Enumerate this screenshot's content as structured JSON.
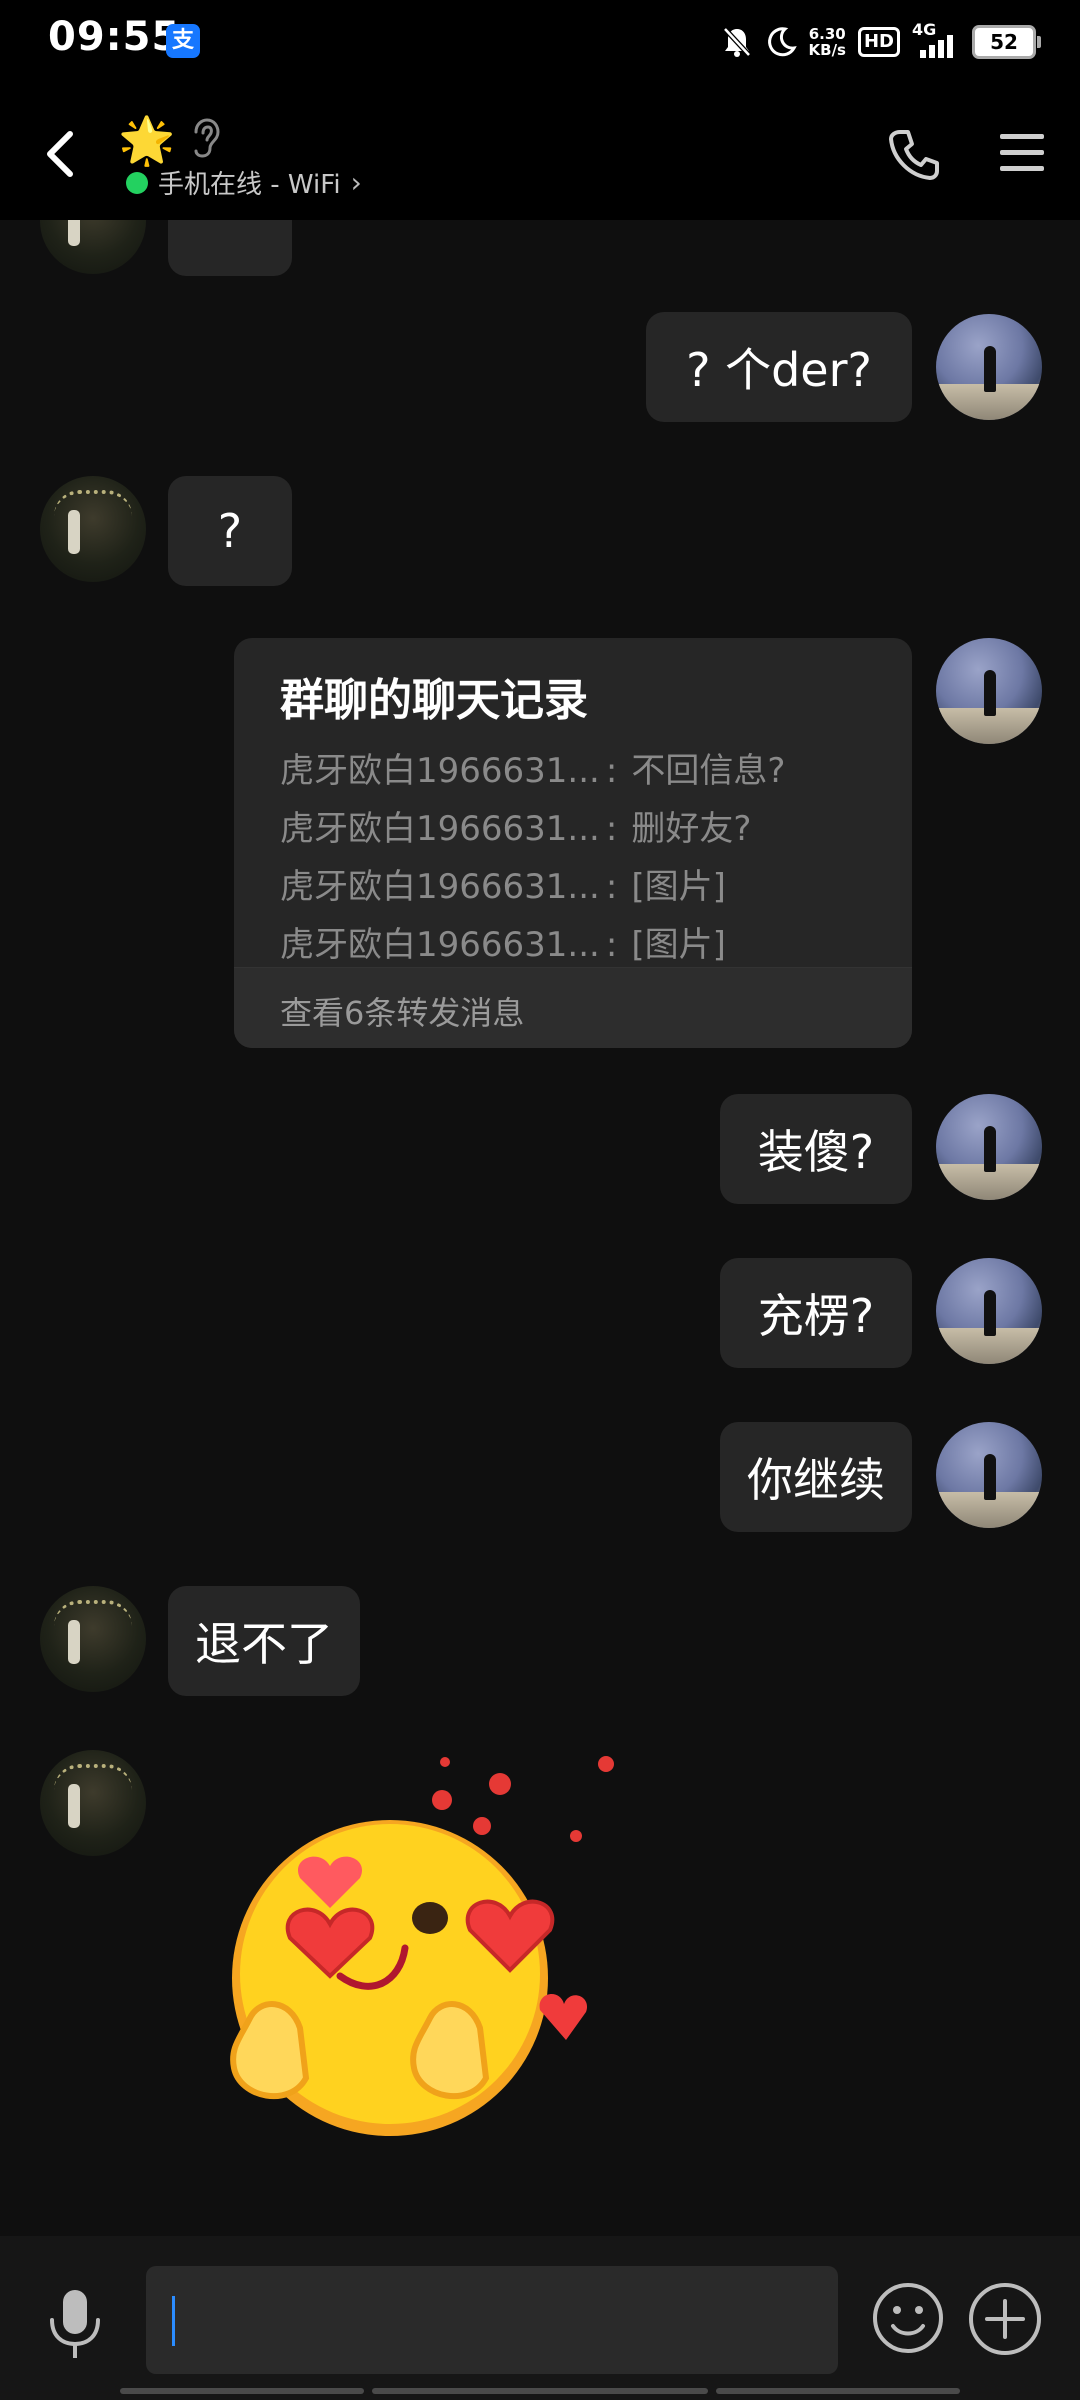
{
  "status_bar": {
    "time": "09:55",
    "app_icon": "支",
    "net_speed_value": "6.30",
    "net_speed_unit": "KB/s",
    "hd": "HD",
    "network": "4G",
    "battery": "52"
  },
  "header": {
    "contact_emoji": "🌟",
    "status_text": "手机在线 - WiFi",
    "status_chevron": "›"
  },
  "messages": {
    "m1": "? 个der?",
    "m2": "?",
    "forward": {
      "title": "群聊的聊天记录",
      "lines": [
        {
          "sender": "虎牙欧白1966631...",
          "sep": ":",
          "text": "不回信息?"
        },
        {
          "sender": "虎牙欧白1966631...",
          "sep": ":",
          "text": "删好友?"
        },
        {
          "sender": "虎牙欧白1966631...",
          "sep": ":",
          "text": "[图片]"
        },
        {
          "sender": "虎牙欧白1966631...",
          "sep": ":",
          "text": "[图片]"
        }
      ],
      "footer": "查看6条转发消息"
    },
    "m4": "装傻?",
    "m5": "充楞?",
    "m6": "你继续",
    "m7": "退不了"
  },
  "colors": {
    "background": "#0f0f0f",
    "bubble": "#262626",
    "online_dot": "#23d160",
    "caret": "#2b8cff"
  },
  "icons": {
    "back": "back-icon",
    "phone": "phone-icon",
    "menu": "menu-icon",
    "mic": "microphone-icon",
    "emoji": "smile-icon",
    "plus": "plus-icon"
  }
}
